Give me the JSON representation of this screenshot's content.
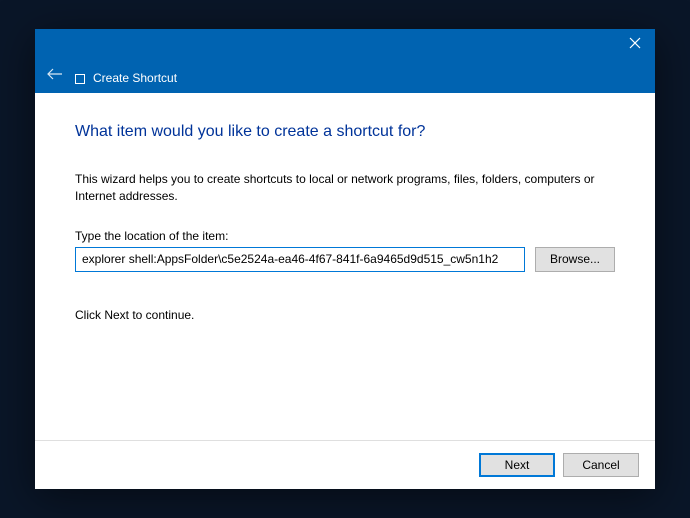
{
  "titlebar": {
    "title": "Create Shortcut"
  },
  "content": {
    "heading": "What item would you like to create a shortcut for?",
    "description": "This wizard helps you to create shortcuts to local or network programs, files, folders, computers or Internet addresses.",
    "location_label": "Type the location of the item:",
    "location_value": "explorer shell:AppsFolder\\c5e2524a-ea46-4f67-841f-6a9465d9d515_cw5n1h2",
    "browse_label": "Browse...",
    "continue_text": "Click Next to continue."
  },
  "footer": {
    "next_label": "Next",
    "cancel_label": "Cancel"
  }
}
